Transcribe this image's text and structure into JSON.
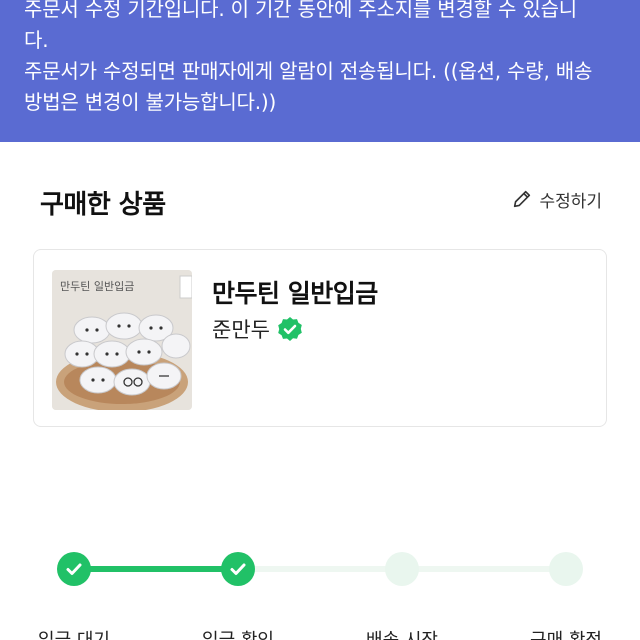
{
  "banner": {
    "line1": "주문서 수정 기간입니다. 이 기간 동안에 주소지를 변경할 수 있습니",
    "line2": "다.",
    "line3": "주문서가 수정되면 판매자에게 알람이 전송됩니다. ((옵션, 수량, 배송",
    "line4": "방법은 변경이 불가능합니다.))"
  },
  "purchased": {
    "title": "구매한 상품",
    "edit_label": "수정하기",
    "edit_icon": "pencil-icon"
  },
  "product": {
    "name": "만두틴 일반입금",
    "seller": "준만두",
    "seller_badge_icon": "verified-badge-icon",
    "image_text": "만두틴 일반입금"
  },
  "progress": {
    "steps": [
      {
        "label": "입금 대기",
        "state": "done"
      },
      {
        "label": "입금 확인",
        "state": "done"
      },
      {
        "label": "배송 시작",
        "state": "pending"
      },
      {
        "label": "구매 확정",
        "state": "pending"
      }
    ],
    "completed_fraction": 0.3333
  },
  "colors": {
    "banner": "#5a6bd2",
    "accent_green": "#21c167",
    "pending_green": "#e9f6ee"
  }
}
